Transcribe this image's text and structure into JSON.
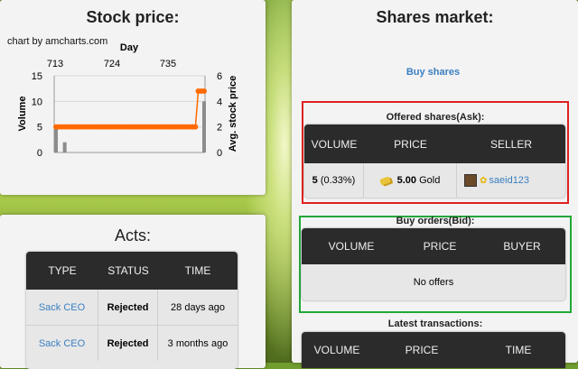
{
  "stock": {
    "title": "Stock price:",
    "credit": "chart by amcharts.com"
  },
  "chart_data": {
    "type": "line",
    "xlabel": "Day",
    "ylabel": "Volume",
    "y2label": "Avg. stock price",
    "x_ticks": [
      "713",
      "724",
      "735"
    ],
    "y_ticks": [
      "0",
      "5",
      "10",
      "15"
    ],
    "y2_ticks": [
      "0",
      "2",
      "4",
      "6"
    ],
    "ylim": [
      0,
      15
    ],
    "y2lim": [
      0,
      6
    ],
    "series": [
      {
        "values": [
          5,
          5,
          5,
          5,
          5,
          5,
          5,
          5,
          5,
          5,
          5,
          5,
          5,
          5,
          5,
          5,
          5,
          5,
          5,
          5,
          5,
          5,
          5,
          5,
          5,
          5,
          5,
          5,
          5,
          5,
          5,
          5,
          5,
          5,
          5,
          5,
          5,
          5,
          5,
          5,
          5,
          5,
          5,
          5,
          5,
          5,
          5,
          5,
          5,
          12,
          12,
          12
        ]
      },
      {
        "values": [
          5,
          0,
          0,
          2,
          0,
          0,
          0,
          0,
          0,
          0,
          0,
          0,
          0,
          0,
          0,
          0,
          0,
          0,
          0,
          0,
          0,
          0,
          0,
          0,
          0,
          0,
          0,
          0,
          0,
          0,
          0,
          0,
          0,
          0,
          0,
          0,
          0,
          0,
          0,
          0,
          0,
          0,
          0,
          0,
          0,
          0,
          0,
          0,
          0,
          0,
          0,
          10
        ]
      }
    ]
  },
  "acts": {
    "title": "Acts:",
    "headers": [
      "TYPE",
      "STATUS",
      "TIME"
    ],
    "rows": [
      {
        "type": "Sack CEO",
        "status": "Rejected",
        "time": "28 days ago"
      },
      {
        "type": "Sack CEO",
        "status": "Rejected",
        "time": "3 months ago"
      }
    ]
  },
  "market": {
    "title": "Shares market:",
    "buy_link": "Buy shares",
    "ask_title": "Offered shares(Ask):",
    "ask_headers": [
      "VOLUME",
      "PRICE",
      "SELLER"
    ],
    "ask_row": {
      "volume": "5",
      "percent": "(0.33%)",
      "price": "5.00",
      "currency": "Gold",
      "seller": "saeid123"
    },
    "bid_title": "Buy orders(Bid):",
    "bid_headers": [
      "VOLUME",
      "PRICE",
      "BUYER"
    ],
    "bid_empty": "No offers",
    "tx_title": "Latest transactions:",
    "tx_headers": [
      "VOLUME",
      "PRICE",
      "TIME"
    ]
  },
  "colors": {
    "accent": "#ff6a00",
    "bars": "#8c8c8c",
    "red_highlight": "#e02020",
    "green_highlight": "#22a83a",
    "link": "#3a7fc1"
  }
}
